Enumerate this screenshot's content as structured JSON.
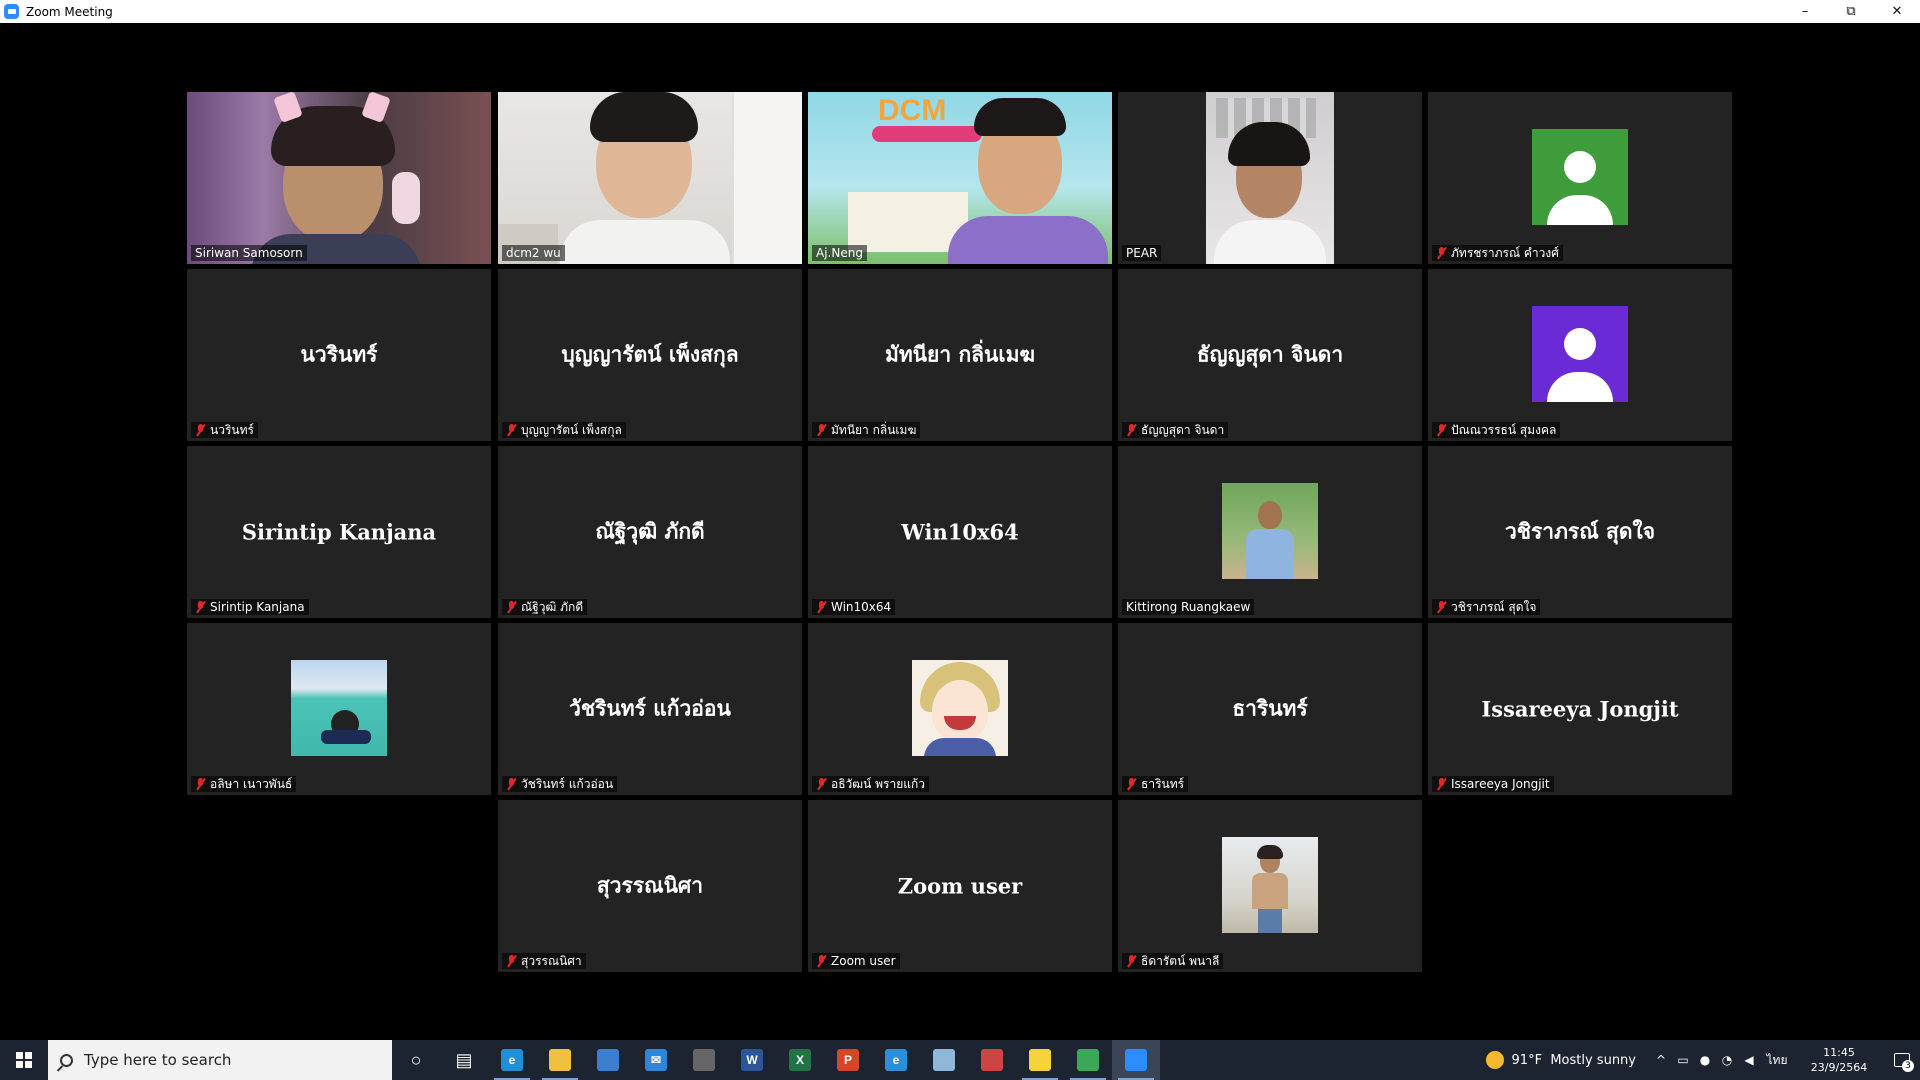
{
  "window": {
    "title": "Zoom Meeting",
    "controls": {
      "minimize": "–",
      "restore": "⧉",
      "close": "✕"
    }
  },
  "colors": {
    "active_speaker_border": "#E4E65A",
    "tile_bg": "#232323",
    "muted_icon": "#E02828"
  },
  "participants": [
    {
      "big": "",
      "label": "Siriwan Samosorn",
      "muted": false
    },
    {
      "big": "",
      "label": "dcm2 wu",
      "muted": false
    },
    {
      "big": "",
      "label": "Aj.Neng",
      "muted": false
    },
    {
      "big": "",
      "label": "PEAR",
      "muted": false
    },
    {
      "big": "",
      "label": "ภัทรชราภรณ์ คำวงศ์",
      "muted": true
    },
    {
      "big": "นวรินทร์",
      "label": "นวรินทร์",
      "muted": true
    },
    {
      "big": "บุญญารัตน์ เพ็งสกุล",
      "label": "บุญญารัตน์ เพ็งสกุล",
      "muted": true
    },
    {
      "big": "มัทนียา กลิ่นเมฆ",
      "label": "มัทนียา กลิ่นเมฆ",
      "muted": true
    },
    {
      "big": "ธัญญสุดา จินดา",
      "label": "ธัญญสุดา จินดา",
      "muted": true
    },
    {
      "big": "",
      "label": "ปัณณวรรธน์ สุมงคล",
      "muted": true
    },
    {
      "big": "Sirintip Kanjana",
      "label": "Sirintip Kanjana",
      "muted": true
    },
    {
      "big": "ณัฐิวุฒิ ภักดี",
      "label": "ณัฐิวุฒิ ภักดี",
      "muted": true
    },
    {
      "big": "Win10x64",
      "label": "Win10x64",
      "muted": true
    },
    {
      "big": "",
      "label": "Kittirong Ruangkaew",
      "muted": false
    },
    {
      "big": "วชิราภรณ์ สุดใจ",
      "label": "วชิราภรณ์ สุดใจ",
      "muted": true
    },
    {
      "big": "",
      "label": "อลิษา เนาวพันธ์",
      "muted": true
    },
    {
      "big": "วัชรินทร์ แก้วอ่อน",
      "label": "วัชรินทร์ แก้วอ่อน",
      "muted": true
    },
    {
      "big": "",
      "label": "อธิวัฒน์ พรายแก้ว",
      "muted": true
    },
    {
      "big": "ธารินทร์",
      "label": "ธารินทร์",
      "muted": true
    },
    {
      "big": "Issareeya Jongjit",
      "label": "Issareeya Jongjit",
      "muted": true
    },
    {
      "big": "สุวรรณนิศา",
      "label": "สุวรรณนิศา",
      "muted": true
    },
    {
      "big": "Zoom user",
      "label": "Zoom user",
      "muted": true
    },
    {
      "big": "",
      "label": "ธิดารัตน์ พนาลี",
      "muted": true
    }
  ],
  "taskbar": {
    "search_placeholder": "Type here to search",
    "apps": [
      {
        "name": "cortana-icon",
        "glyph": "○",
        "color": "transparent"
      },
      {
        "name": "task-view-icon",
        "glyph": "▤",
        "color": "transparent"
      },
      {
        "name": "edge-icon",
        "glyph": "e",
        "color": "#1f8fd6"
      },
      {
        "name": "file-explorer-icon",
        "glyph": "",
        "color": "#f0c040"
      },
      {
        "name": "store-icon",
        "glyph": "",
        "color": "#3c7fd0"
      },
      {
        "name": "mail-icon",
        "glyph": "✉",
        "color": "#2d86d8"
      },
      {
        "name": "game-icon",
        "glyph": "",
        "color": "#666"
      },
      {
        "name": "word-icon",
        "glyph": "W",
        "color": "#2b579a"
      },
      {
        "name": "excel-icon",
        "glyph": "X",
        "color": "#217346"
      },
      {
        "name": "powerpoint-icon",
        "glyph": "P",
        "color": "#d24726"
      },
      {
        "name": "ie-icon",
        "glyph": "e",
        "color": "#2b8fd9"
      },
      {
        "name": "notes-icon",
        "glyph": "",
        "color": "#8fb8d8"
      },
      {
        "name": "paint-icon",
        "glyph": "",
        "color": "#c44"
      },
      {
        "name": "sticky-notes-icon",
        "glyph": "",
        "color": "#f7d33a"
      },
      {
        "name": "chrome-icon",
        "glyph": "",
        "color": "#3aa757"
      },
      {
        "name": "zoom-icon",
        "glyph": "",
        "color": "#2D8CFF"
      }
    ],
    "weather_temp": "91°F",
    "weather_text": "Mostly sunny",
    "lang": "ไทย",
    "time": "11:45",
    "date": "23/9/2564",
    "notifications": "3"
  }
}
